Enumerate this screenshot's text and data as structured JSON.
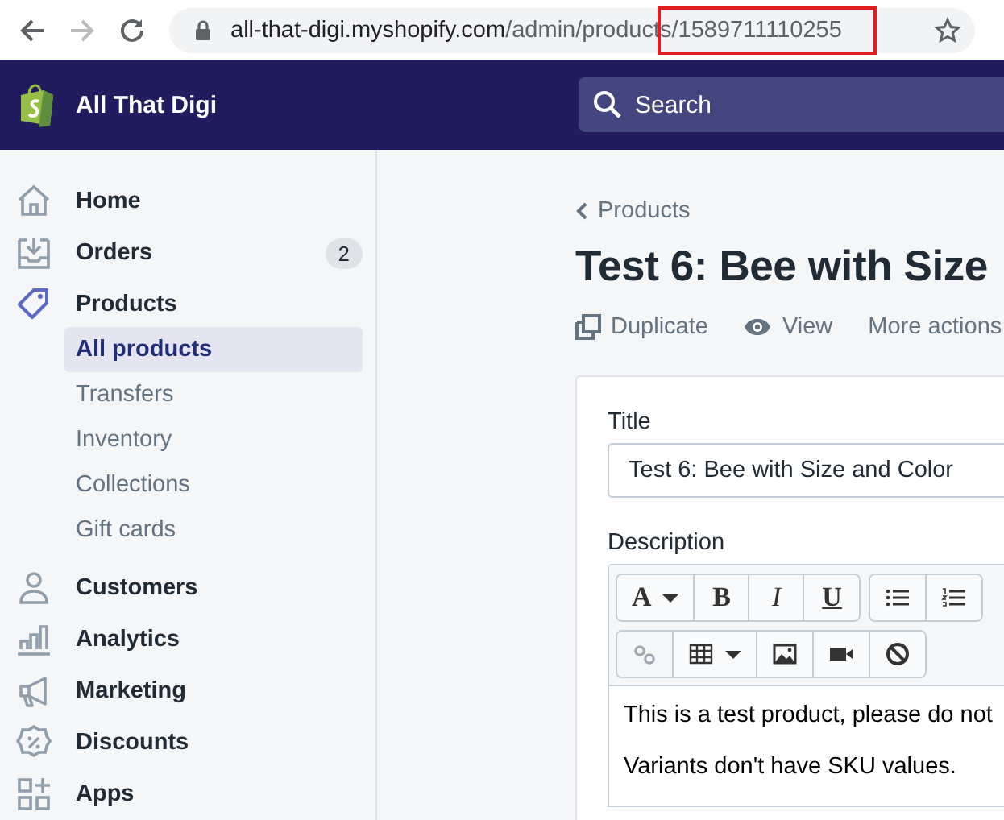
{
  "browser": {
    "back": {
      "disabled": false
    },
    "forward": {
      "disabled": true
    },
    "url": [
      {
        "text": "all-that-digi.myshopify.com",
        "kind": "host",
        "highlighted": false
      },
      {
        "text": "/admin/product",
        "kind": "path",
        "highlighted": false
      },
      {
        "text": "s/1589711110255",
        "kind": "path",
        "highlighted": true
      }
    ]
  },
  "topbar": {
    "store_name": "All That Digi",
    "search": {
      "placeholder": "Search"
    }
  },
  "sidebar": {
    "items": [
      {
        "label": "Home",
        "selected": false
      },
      {
        "label": "Orders",
        "selected": false,
        "badge": "2"
      },
      {
        "label": "Products",
        "selected": true,
        "children": [
          {
            "label": "All products",
            "selected": true
          },
          {
            "label": "Transfers",
            "selected": false
          },
          {
            "label": "Inventory",
            "selected": false
          },
          {
            "label": "Collections",
            "selected": false
          },
          {
            "label": "Gift cards",
            "selected": false
          }
        ]
      },
      {
        "label": "Customers",
        "selected": false
      },
      {
        "label": "Analytics",
        "selected": false
      },
      {
        "label": "Marketing",
        "selected": false
      },
      {
        "label": "Discounts",
        "selected": false
      },
      {
        "label": "Apps",
        "selected": false
      }
    ]
  },
  "page": {
    "breadcrumb": "Products",
    "title": "Test 6: Bee with Size",
    "actions": [
      {
        "label": "Duplicate",
        "kind": "duplicate"
      },
      {
        "label": "View",
        "kind": "view"
      },
      {
        "label": "More actions",
        "kind": "more"
      }
    ],
    "form": {
      "title_label": "Title",
      "title_value": "Test 6: Bee with Size and Color",
      "description_label": "Description",
      "toolbar": [
        [
          {
            "kind": "font",
            "label": "A",
            "dropdown": true,
            "disabled": false
          },
          {
            "kind": "bold",
            "label": "B",
            "disabled": false
          },
          {
            "kind": "italic",
            "label": "I",
            "disabled": false
          },
          {
            "kind": "underline",
            "label": "U",
            "disabled": false
          }
        ],
        [
          {
            "kind": "bullets",
            "disabled": false
          },
          {
            "kind": "numbers",
            "disabled": false
          }
        ]
      ],
      "toolbar2": [
        [
          {
            "kind": "link",
            "disabled": true
          },
          {
            "kind": "table",
            "dropdown": true,
            "disabled": false
          },
          {
            "kind": "image",
            "disabled": false
          },
          {
            "kind": "video",
            "disabled": false
          },
          {
            "kind": "clear",
            "disabled": false
          }
        ]
      ],
      "body": [
        "This is a test product, please do not",
        "Variants don't have SKU values."
      ]
    }
  }
}
